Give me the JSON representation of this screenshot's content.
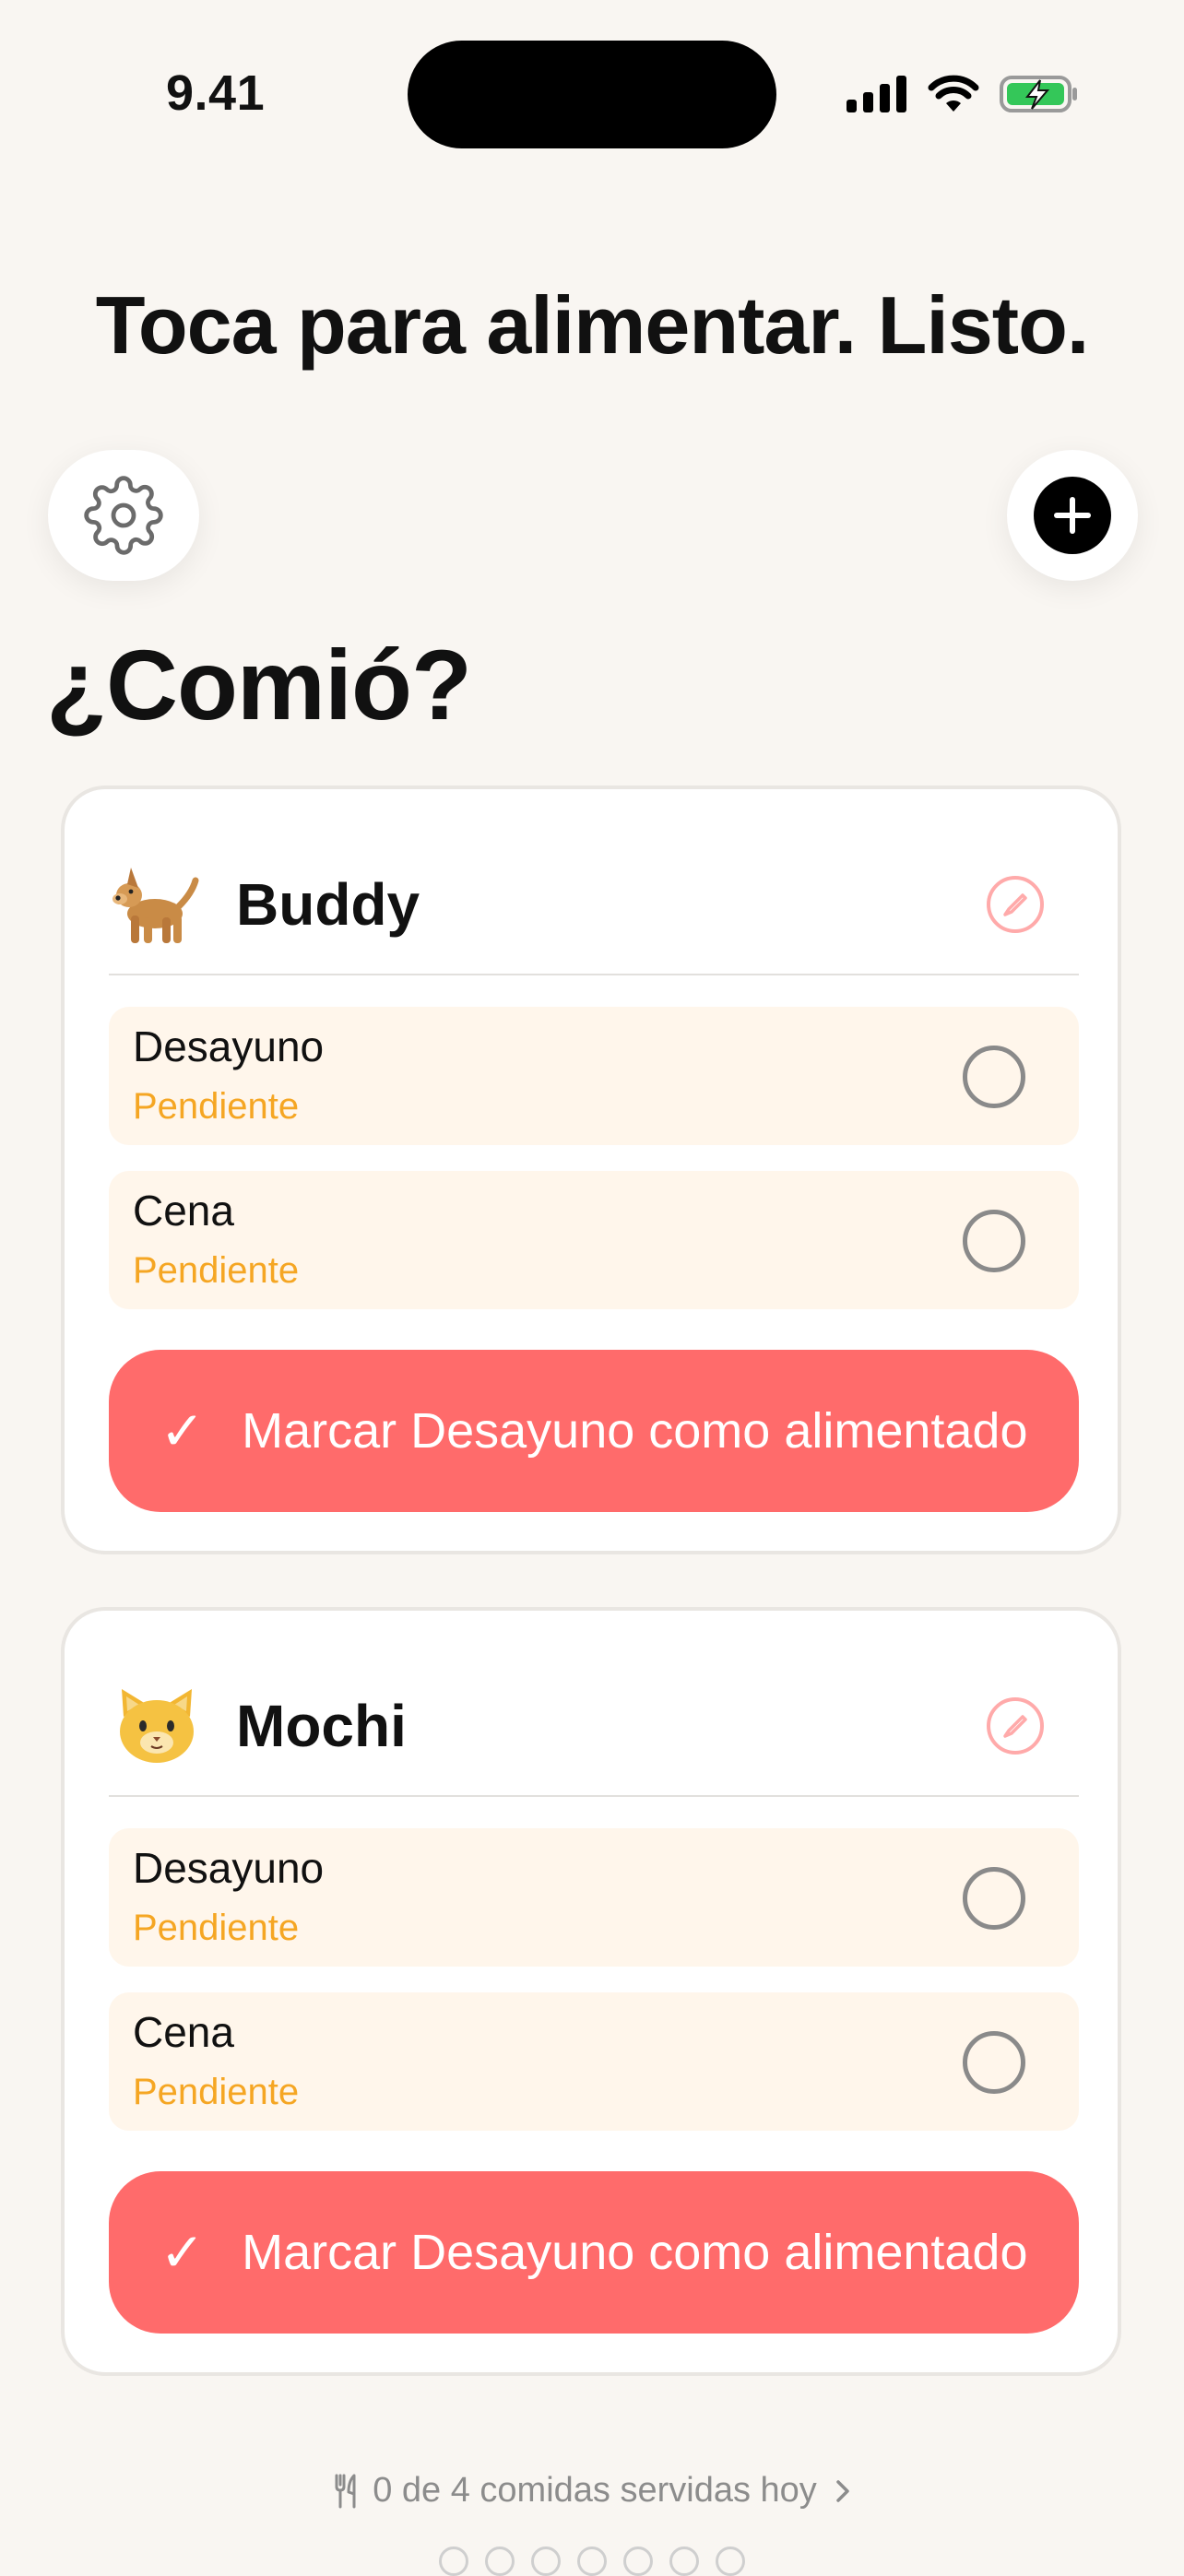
{
  "status_bar": {
    "time": "9.41",
    "icons": [
      "cellular-signal-icon",
      "wifi-icon",
      "battery-charging-icon"
    ]
  },
  "headline": "Toca para alimentar. Listo.",
  "toolbar": {
    "settings_icon": "gear-icon",
    "add_icon": "plus-circle-icon"
  },
  "section_title": "¿Comió?",
  "colors": {
    "accent": "#FF6B6B",
    "pending": "#F5A623",
    "meal_bg": "#FFF6EB",
    "page_bg": "#F9F6F2"
  },
  "pets": [
    {
      "emoji": "dog-emoji",
      "name": "Buddy",
      "meals": [
        {
          "name": "Desayuno",
          "status": "Pendiente"
        },
        {
          "name": "Cena",
          "status": "Pendiente"
        }
      ],
      "action_label": "Marcar Desayuno como alimentado"
    },
    {
      "emoji": "cat-emoji",
      "name": "Mochi",
      "meals": [
        {
          "name": "Desayuno",
          "status": "Pendiente"
        },
        {
          "name": "Cena",
          "status": "Pendiente"
        }
      ],
      "action_label": "Marcar Desayuno como alimentado"
    }
  ],
  "footer": {
    "summary": "0 de 4 comidas servidas hoy",
    "icon": "fork-knife-icon"
  },
  "page_dots": 7
}
